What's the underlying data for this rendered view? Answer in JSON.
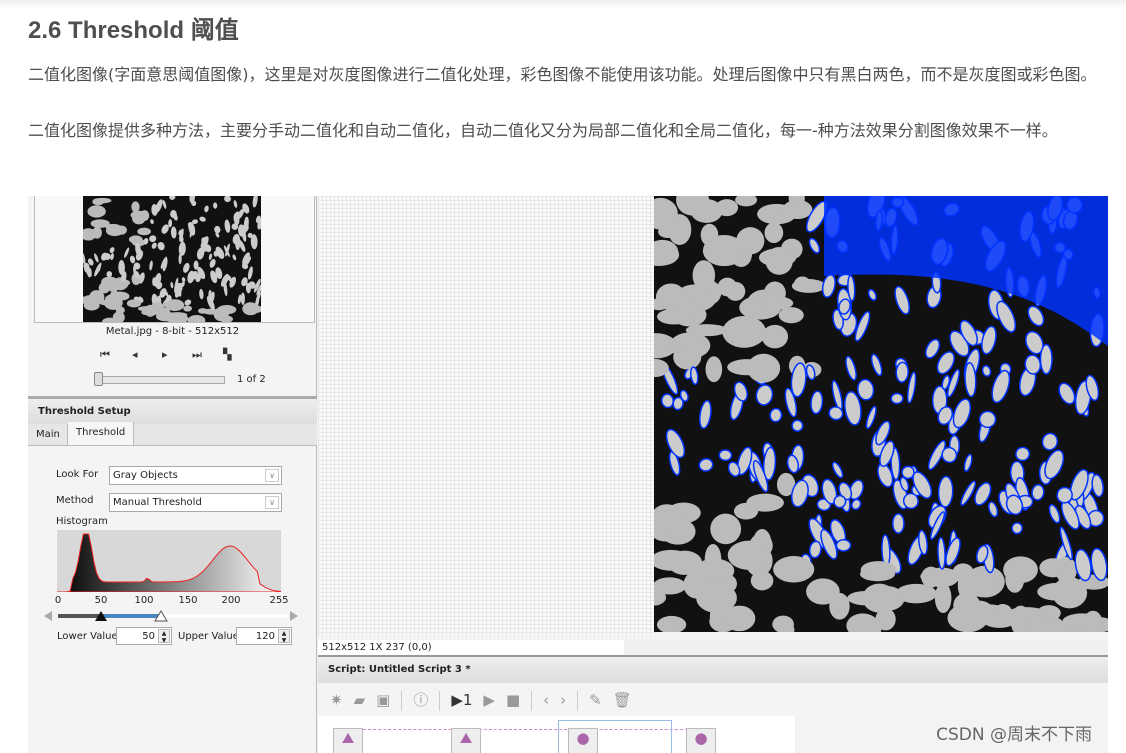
{
  "article": {
    "heading": "2.6 Threshold 阈值",
    "paragraphs": [
      "二值化图像(字面意思阈值图像)，这里是对灰度图像进行二值化处理，彩色图像不能使用该功能。处理后图像中只有黑白两色，而不是灰度图或彩色图。",
      "二值化图像提供多种方法，主要分手动二值化和自动二值化，自动二值化又分为局部二值化和全局二值化，每一-种方法效果分割图像效果不一样。"
    ]
  },
  "app": {
    "thumbnail_caption": "Metal.jpg - 8-bit - 512x512",
    "nav_icons": [
      "first-icon",
      "prev-icon",
      "next-icon",
      "last-icon",
      "layout-icon"
    ],
    "page_indicator": "1 of 2",
    "page_slider": {
      "current": 1,
      "total": 2
    },
    "threshold_setup": {
      "title": "Threshold Setup",
      "tabs": [
        {
          "label": "Main",
          "active": false
        },
        {
          "label": "Threshold",
          "active": true
        }
      ],
      "look_for_label": "Look For",
      "look_for_value": "Gray Objects",
      "method_label": "Method",
      "method_value": "Manual Threshold",
      "histogram_label": "Histogram",
      "histogram_ticks": [
        "0",
        "50",
        "100",
        "150",
        "200",
        "255"
      ],
      "lower_label": "Lower Value",
      "lower_value": "50",
      "upper_label": "Upper Value",
      "upper_value": "120"
    },
    "status_text": "512x512 1X 237   (0,0)",
    "script_title": "Script: Untitled Script 3 *",
    "overlay_color": "#0033ff",
    "slider_range_color": "#4a86c0"
  },
  "watermark": "CSDN @周末不下雨"
}
